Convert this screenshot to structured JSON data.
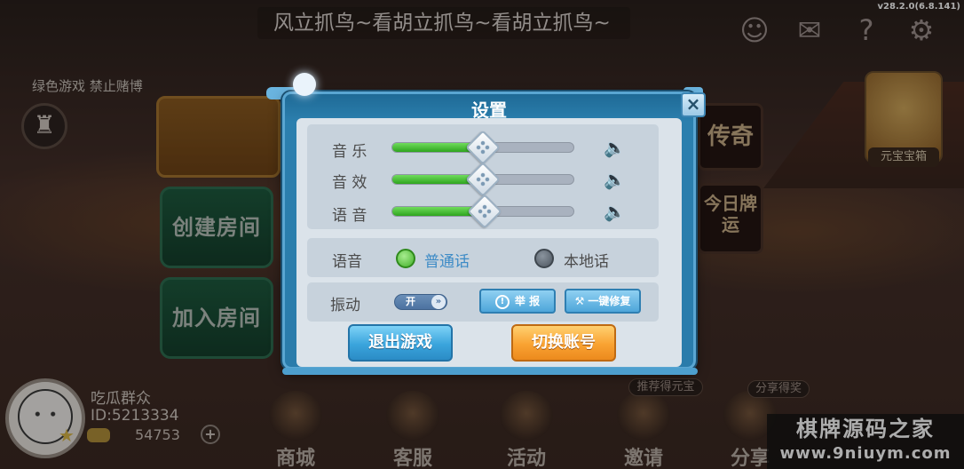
{
  "header": {
    "marquee": "风立抓鸟~看胡立抓鸟~看胡立抓鸟~",
    "version": "v28.2.0(6.8.141)",
    "icons": [
      "user-check-icon",
      "mail-icon",
      "help-icon",
      "gear-icon"
    ]
  },
  "lobby": {
    "notice": "绿色游戏 禁止赌博",
    "create_room": "创建房间",
    "join_room": "加入房间",
    "side_card_1": "传奇",
    "side_card_2": "今日牌运",
    "god_label": "元宝宝箱"
  },
  "player": {
    "nickname": "吃瓜群众",
    "id": "ID:5213334",
    "coins": "54753",
    "add": "+"
  },
  "nav": {
    "items": [
      {
        "label": "商城",
        "icon": "shop-icon"
      },
      {
        "label": "客服",
        "icon": "service-icon"
      },
      {
        "label": "活动",
        "icon": "activity-icon"
      },
      {
        "label": "邀请",
        "icon": "invite-icon"
      },
      {
        "label": "分享",
        "icon": "share-icon"
      }
    ],
    "tag_invite": "推荐得元宝",
    "tag_share": "分享得奖"
  },
  "watermark": {
    "title": "棋牌源码之家",
    "url": "www.9niuym.com"
  },
  "settings_dialog": {
    "title": "设置",
    "close": "×",
    "sliders": [
      {
        "label": "音 乐",
        "value": 0.5
      },
      {
        "label": "音 效",
        "value": 0.5
      },
      {
        "label": "语 音",
        "value": 0.5
      }
    ],
    "language": {
      "label": "语音",
      "options": [
        "普通话",
        "本地话"
      ],
      "selected": "普通话"
    },
    "vibration": {
      "label": "振动",
      "toggle_text": "开",
      "state": "on"
    },
    "report_button": "举 报",
    "repair_button": "一键修复",
    "exit_button": "退出游戏",
    "switch_button": "切换账号"
  },
  "colors": {
    "dialog_frame": "#2b7fae",
    "slider_fill": "#3cb72a",
    "radio_on": "#43b02a",
    "exit_button": "#3aa4dc",
    "switch_button": "#f9a232"
  }
}
